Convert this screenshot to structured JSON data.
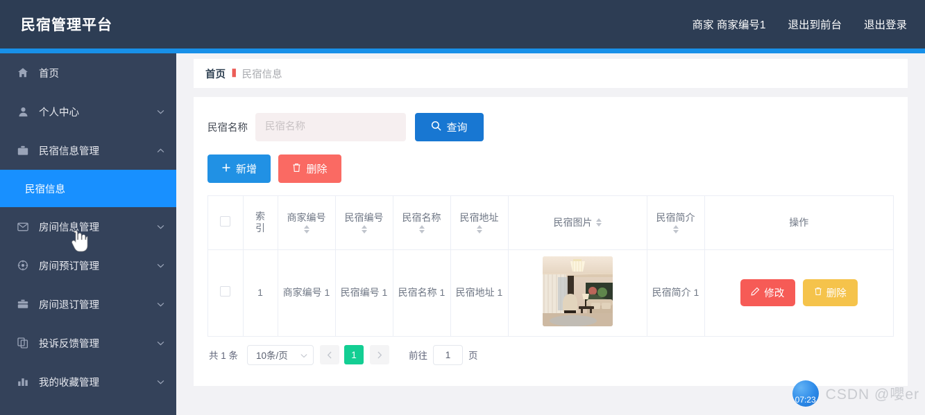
{
  "header": {
    "brand": "民宿管理平台",
    "user": "商家 商家编号1",
    "exit_front": "退出到前台",
    "logout": "退出登录"
  },
  "sidebar": {
    "items": [
      {
        "label": "首页",
        "icon": "home-icon",
        "chevron": "",
        "expanded": false
      },
      {
        "label": "个人中心",
        "icon": "user-icon",
        "chevron": "down",
        "expanded": false
      },
      {
        "label": "民宿信息管理",
        "icon": "briefcase-icon",
        "chevron": "up",
        "expanded": true
      },
      {
        "label": "房间信息管理",
        "icon": "envelope-icon",
        "chevron": "down",
        "expanded": false
      },
      {
        "label": "房间预订管理",
        "icon": "compass-icon",
        "chevron": "down",
        "expanded": false
      },
      {
        "label": "房间退订管理",
        "icon": "suitcase-icon",
        "chevron": "down",
        "expanded": false
      },
      {
        "label": "投诉反馈管理",
        "icon": "copy-icon",
        "chevron": "down",
        "expanded": false
      },
      {
        "label": "我的收藏管理",
        "icon": "bar-chart-icon",
        "chevron": "down",
        "expanded": false
      }
    ],
    "submenu": {
      "label": "民宿信息",
      "active": true
    },
    "active_color": "#1890ff"
  },
  "breadcrumb": {
    "home": "首页",
    "separator": "⦀",
    "current": "民宿信息"
  },
  "search": {
    "label": "民宿名称",
    "placeholder": "民宿名称",
    "value": "",
    "button_label": "查询",
    "button_icon": "search-icon"
  },
  "toolbar": {
    "add_label": "新增",
    "add_icon": "plus-icon",
    "delete_label": "删除",
    "delete_icon": "trash-icon"
  },
  "table": {
    "columns": [
      {
        "key": "check",
        "label": "",
        "sortable": false
      },
      {
        "key": "index",
        "label": "索 引",
        "sortable": false
      },
      {
        "key": "merchant_no",
        "label": "商家编号",
        "sortable": true
      },
      {
        "key": "hotel_no",
        "label": "民宿编号",
        "sortable": true
      },
      {
        "key": "hotel_name",
        "label": "民宿名称",
        "sortable": true
      },
      {
        "key": "hotel_addr",
        "label": "民宿地址",
        "sortable": true
      },
      {
        "key": "hotel_pic",
        "label": "民宿图片",
        "sortable": true
      },
      {
        "key": "hotel_desc",
        "label": "民宿简介",
        "sortable": true
      },
      {
        "key": "ops",
        "label": "操作",
        "sortable": false
      }
    ],
    "rows": [
      {
        "index": "1",
        "merchant_no": "商家编号 1",
        "hotel_no": "民宿编号 1",
        "hotel_name": "民宿名称 1",
        "hotel_addr": "民宿地址 1",
        "hotel_desc": "民宿简介 1",
        "picture_alt": "民宿图片",
        "edit_label": "修改",
        "delete_label": "删除"
      }
    ]
  },
  "pagination": {
    "total_text": "共 1 条",
    "page_size": "10条/页",
    "prev_icon": "chevron-left-icon",
    "next_icon": "chevron-right-icon",
    "current_page": "1",
    "goto_label": "前往",
    "goto_value": "1",
    "goto_unit": "页"
  },
  "watermark": {
    "time": "07:23",
    "text": "CSDN @嚶er"
  }
}
